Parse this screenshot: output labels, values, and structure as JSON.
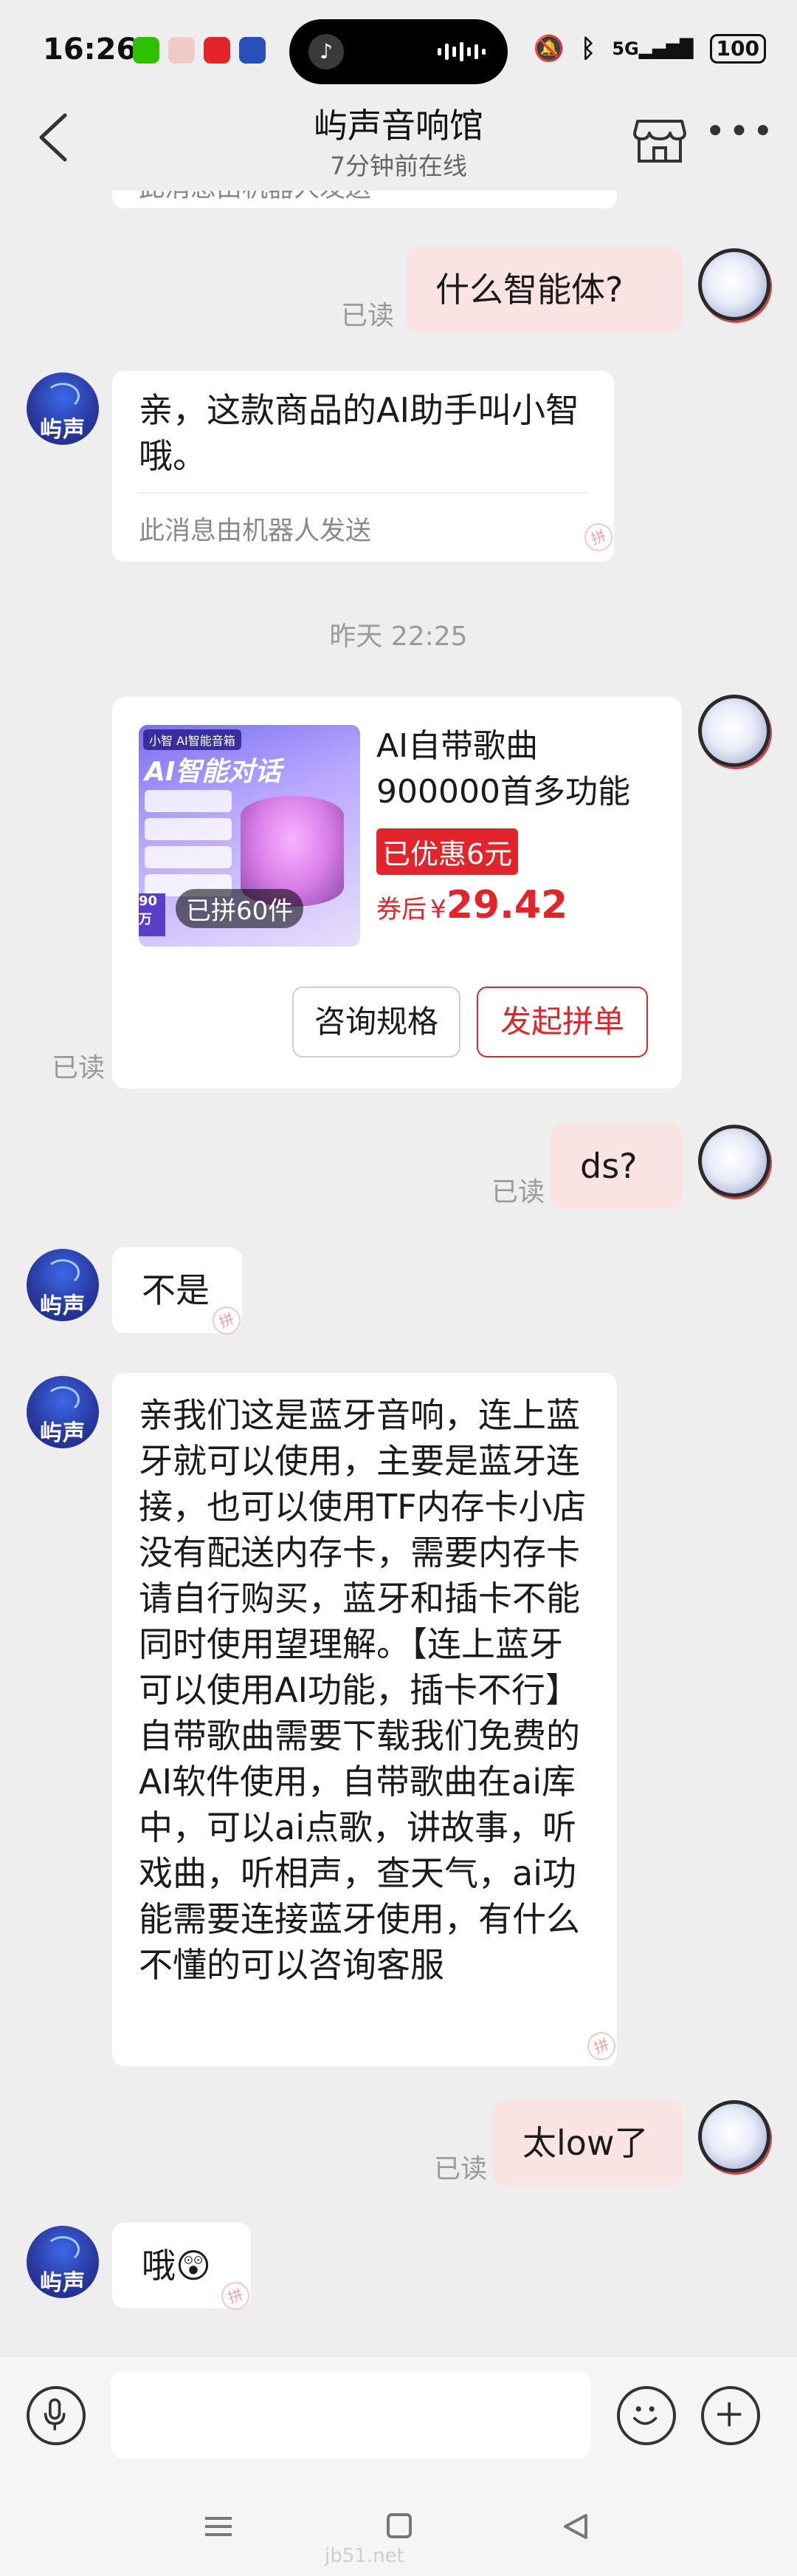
{
  "status_bar": {
    "time": "16:26",
    "network": "5G",
    "battery": "100"
  },
  "header": {
    "title": "屿声音响馆",
    "subtitle": "7分钟前在线"
  },
  "shop_avatar_text": "屿声",
  "messages": {
    "partial_bot_note": "此消息由机器人发送",
    "q1": {
      "text": "什么智能体?",
      "status": "已读"
    },
    "a1": {
      "text": "亲，这款商品的AI助手叫小智哦。",
      "note": "此消息由机器人发送"
    },
    "timestamp": "昨天 22:25",
    "card": {
      "image_tag": "小智 AI智能音箱",
      "image_headline": "AI智能对话",
      "image_badge_text": "90万",
      "sold": "已拼60件",
      "title": "AI自带歌曲900000首多功能",
      "promo": "已优惠6元",
      "price_prefix": "券后",
      "currency": "¥",
      "price": "29.42",
      "btn_spec": "咨询规格",
      "btn_group": "发起拼单",
      "status": "已读"
    },
    "q2": {
      "text": "ds?",
      "status": "已读"
    },
    "a2": {
      "text": "不是"
    },
    "a3": {
      "text": "亲我们这是蓝牙音响，连上蓝牙就可以使用，主要是蓝牙连接，也可以使用TF内存卡小店没有配送内存卡，需要内存卡请自行购买，蓝牙和插卡不能同时使用望理解。【连上蓝牙可以使用AI功能，插卡不行】自带歌曲需要下载我们免费的AI软件使用，自带歌曲在ai库中，可以ai点歌，讲故事，听戏曲，听相声，查天气，ai功能需要连接蓝牙使用，有什么不懂的可以咨询客服"
    },
    "q3": {
      "text": "太low了",
      "status": "已读"
    },
    "a4": {
      "text": "哦😲"
    }
  },
  "stamp_text": "拼",
  "watermark": "jb51.net",
  "icons": [
    "back-arrow-icon",
    "shop-icon",
    "more-icon",
    "microphone-icon",
    "emoji-icon",
    "plus-icon",
    "nav-menu-icon",
    "nav-home-icon",
    "nav-back-icon"
  ],
  "colors": {
    "accent": "#e3242b",
    "own_bubble": "#f9e4e3",
    "background": "#eeeeee"
  }
}
